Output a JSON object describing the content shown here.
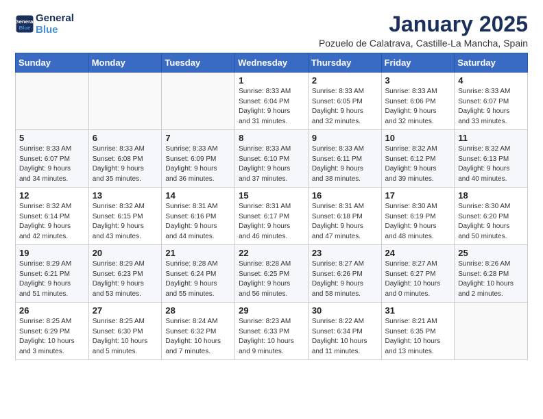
{
  "logo": {
    "text_general": "General",
    "text_blue": "Blue"
  },
  "header": {
    "title": "January 2025",
    "subtitle": "Pozuelo de Calatrava, Castille-La Mancha, Spain"
  },
  "weekdays": [
    "Sunday",
    "Monday",
    "Tuesday",
    "Wednesday",
    "Thursday",
    "Friday",
    "Saturday"
  ],
  "weeks": [
    [
      {
        "day": "",
        "info": ""
      },
      {
        "day": "",
        "info": ""
      },
      {
        "day": "",
        "info": ""
      },
      {
        "day": "1",
        "info": "Sunrise: 8:33 AM\nSunset: 6:04 PM\nDaylight: 9 hours\nand 31 minutes."
      },
      {
        "day": "2",
        "info": "Sunrise: 8:33 AM\nSunset: 6:05 PM\nDaylight: 9 hours\nand 32 minutes."
      },
      {
        "day": "3",
        "info": "Sunrise: 8:33 AM\nSunset: 6:06 PM\nDaylight: 9 hours\nand 32 minutes."
      },
      {
        "day": "4",
        "info": "Sunrise: 8:33 AM\nSunset: 6:07 PM\nDaylight: 9 hours\nand 33 minutes."
      }
    ],
    [
      {
        "day": "5",
        "info": "Sunrise: 8:33 AM\nSunset: 6:07 PM\nDaylight: 9 hours\nand 34 minutes."
      },
      {
        "day": "6",
        "info": "Sunrise: 8:33 AM\nSunset: 6:08 PM\nDaylight: 9 hours\nand 35 minutes."
      },
      {
        "day": "7",
        "info": "Sunrise: 8:33 AM\nSunset: 6:09 PM\nDaylight: 9 hours\nand 36 minutes."
      },
      {
        "day": "8",
        "info": "Sunrise: 8:33 AM\nSunset: 6:10 PM\nDaylight: 9 hours\nand 37 minutes."
      },
      {
        "day": "9",
        "info": "Sunrise: 8:33 AM\nSunset: 6:11 PM\nDaylight: 9 hours\nand 38 minutes."
      },
      {
        "day": "10",
        "info": "Sunrise: 8:32 AM\nSunset: 6:12 PM\nDaylight: 9 hours\nand 39 minutes."
      },
      {
        "day": "11",
        "info": "Sunrise: 8:32 AM\nSunset: 6:13 PM\nDaylight: 9 hours\nand 40 minutes."
      }
    ],
    [
      {
        "day": "12",
        "info": "Sunrise: 8:32 AM\nSunset: 6:14 PM\nDaylight: 9 hours\nand 42 minutes."
      },
      {
        "day": "13",
        "info": "Sunrise: 8:32 AM\nSunset: 6:15 PM\nDaylight: 9 hours\nand 43 minutes."
      },
      {
        "day": "14",
        "info": "Sunrise: 8:31 AM\nSunset: 6:16 PM\nDaylight: 9 hours\nand 44 minutes."
      },
      {
        "day": "15",
        "info": "Sunrise: 8:31 AM\nSunset: 6:17 PM\nDaylight: 9 hours\nand 46 minutes."
      },
      {
        "day": "16",
        "info": "Sunrise: 8:31 AM\nSunset: 6:18 PM\nDaylight: 9 hours\nand 47 minutes."
      },
      {
        "day": "17",
        "info": "Sunrise: 8:30 AM\nSunset: 6:19 PM\nDaylight: 9 hours\nand 48 minutes."
      },
      {
        "day": "18",
        "info": "Sunrise: 8:30 AM\nSunset: 6:20 PM\nDaylight: 9 hours\nand 50 minutes."
      }
    ],
    [
      {
        "day": "19",
        "info": "Sunrise: 8:29 AM\nSunset: 6:21 PM\nDaylight: 9 hours\nand 51 minutes."
      },
      {
        "day": "20",
        "info": "Sunrise: 8:29 AM\nSunset: 6:23 PM\nDaylight: 9 hours\nand 53 minutes."
      },
      {
        "day": "21",
        "info": "Sunrise: 8:28 AM\nSunset: 6:24 PM\nDaylight: 9 hours\nand 55 minutes."
      },
      {
        "day": "22",
        "info": "Sunrise: 8:28 AM\nSunset: 6:25 PM\nDaylight: 9 hours\nand 56 minutes."
      },
      {
        "day": "23",
        "info": "Sunrise: 8:27 AM\nSunset: 6:26 PM\nDaylight: 9 hours\nand 58 minutes."
      },
      {
        "day": "24",
        "info": "Sunrise: 8:27 AM\nSunset: 6:27 PM\nDaylight: 10 hours\nand 0 minutes."
      },
      {
        "day": "25",
        "info": "Sunrise: 8:26 AM\nSunset: 6:28 PM\nDaylight: 10 hours\nand 2 minutes."
      }
    ],
    [
      {
        "day": "26",
        "info": "Sunrise: 8:25 AM\nSunset: 6:29 PM\nDaylight: 10 hours\nand 3 minutes."
      },
      {
        "day": "27",
        "info": "Sunrise: 8:25 AM\nSunset: 6:30 PM\nDaylight: 10 hours\nand 5 minutes."
      },
      {
        "day": "28",
        "info": "Sunrise: 8:24 AM\nSunset: 6:32 PM\nDaylight: 10 hours\nand 7 minutes."
      },
      {
        "day": "29",
        "info": "Sunrise: 8:23 AM\nSunset: 6:33 PM\nDaylight: 10 hours\nand 9 minutes."
      },
      {
        "day": "30",
        "info": "Sunrise: 8:22 AM\nSunset: 6:34 PM\nDaylight: 10 hours\nand 11 minutes."
      },
      {
        "day": "31",
        "info": "Sunrise: 8:21 AM\nSunset: 6:35 PM\nDaylight: 10 hours\nand 13 minutes."
      },
      {
        "day": "",
        "info": ""
      }
    ]
  ]
}
